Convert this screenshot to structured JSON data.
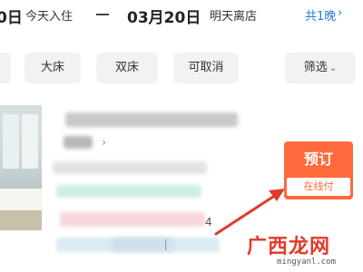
{
  "date_bar": {
    "checkin_date": "0日",
    "checkin_label": "今天入住",
    "checkout_date": "03月20日",
    "checkout_label": "明天离店",
    "nights": "共1晚",
    "nights_chevron": "›"
  },
  "filters": {
    "chips": [
      "",
      "大床",
      "双床",
      "可取消"
    ],
    "filter_label": "筛选",
    "filter_chevron": "⌄"
  },
  "room": {
    "title_chevron": "›",
    "price_tail": "4",
    "book_label": "预订",
    "pay_label": "在线付"
  },
  "watermark": {
    "text": "广西龙网",
    "url": "mingyanl.com"
  },
  "colors": {
    "accent_blue": "#2b7bd8",
    "book_orange": "#ff6a3d",
    "annotation_red": "#e23a2a"
  }
}
